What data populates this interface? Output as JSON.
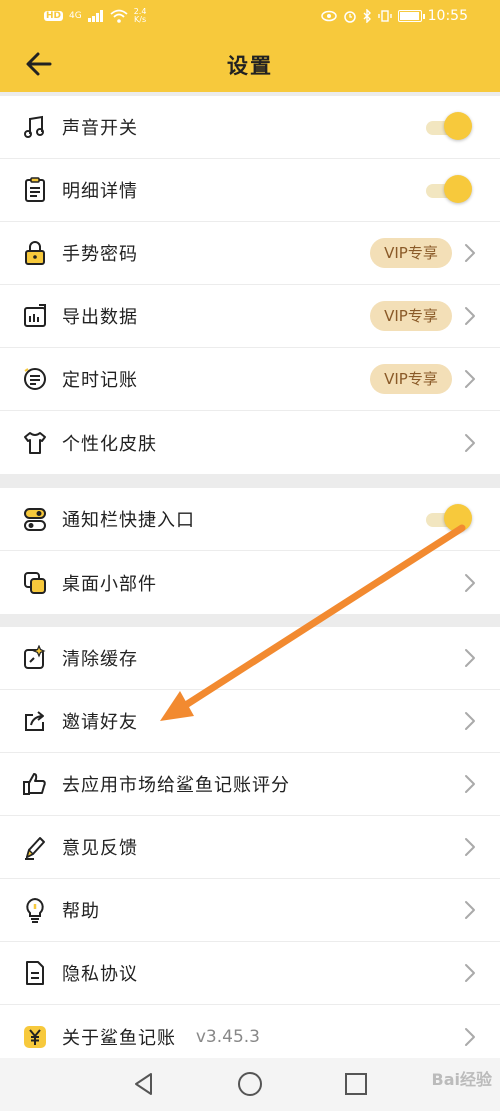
{
  "status_bar": {
    "network": "HD",
    "signal": "4G",
    "speed_value": "2.4",
    "speed_unit": "K/s",
    "time": "10:55",
    "battery_level": 0.9
  },
  "header": {
    "title": "设置",
    "back_icon": "arrow-left-icon"
  },
  "groups": [
    {
      "items": [
        {
          "icon": "music-note-icon",
          "label": "声音开关",
          "control": "toggle",
          "toggle_on": true
        },
        {
          "icon": "clipboard-list-icon",
          "label": "明细详情",
          "control": "toggle",
          "toggle_on": true
        },
        {
          "icon": "lock-icon",
          "label": "手势密码",
          "control": "vip",
          "badge": "VIP专享"
        },
        {
          "icon": "export-chart-icon",
          "label": "导出数据",
          "control": "vip",
          "badge": "VIP专享"
        },
        {
          "icon": "timer-list-icon",
          "label": "定时记账",
          "control": "vip",
          "badge": "VIP专享"
        },
        {
          "icon": "tshirt-icon",
          "label": "个性化皮肤",
          "control": "chevron"
        }
      ]
    },
    {
      "items": [
        {
          "icon": "toggle-switches-icon",
          "label": "通知栏快捷入口",
          "control": "toggle",
          "toggle_on": true
        },
        {
          "icon": "widget-icon",
          "label": "桌面小部件",
          "control": "chevron"
        }
      ]
    },
    {
      "items": [
        {
          "icon": "sparkle-clean-icon",
          "label": "清除缓存",
          "control": "chevron"
        },
        {
          "icon": "share-icon",
          "label": "邀请好友",
          "control": "chevron"
        },
        {
          "icon": "thumbs-up-icon",
          "label": "去应用市场给鲨鱼记账评分",
          "control": "chevron"
        },
        {
          "icon": "pen-icon",
          "label": "意见反馈",
          "control": "chevron"
        },
        {
          "icon": "lightbulb-icon",
          "label": "帮助",
          "control": "chevron"
        },
        {
          "icon": "document-icon",
          "label": "隐私协议",
          "control": "chevron"
        },
        {
          "icon": "yen-logo-icon",
          "label": "关于鲨鱼记账",
          "control": "version",
          "version": "v3.45.3"
        }
      ]
    }
  ],
  "nav_bar": {
    "back": "triangle-back-icon",
    "home": "circle-home-icon",
    "recents": "square-recents-icon"
  },
  "watermark": "Bai经验",
  "colors": {
    "accent": "#f7c93c",
    "vip_bg": "#f3dfb7",
    "vip_text": "#8a5a28",
    "annotation_arrow": "#f28a30"
  }
}
